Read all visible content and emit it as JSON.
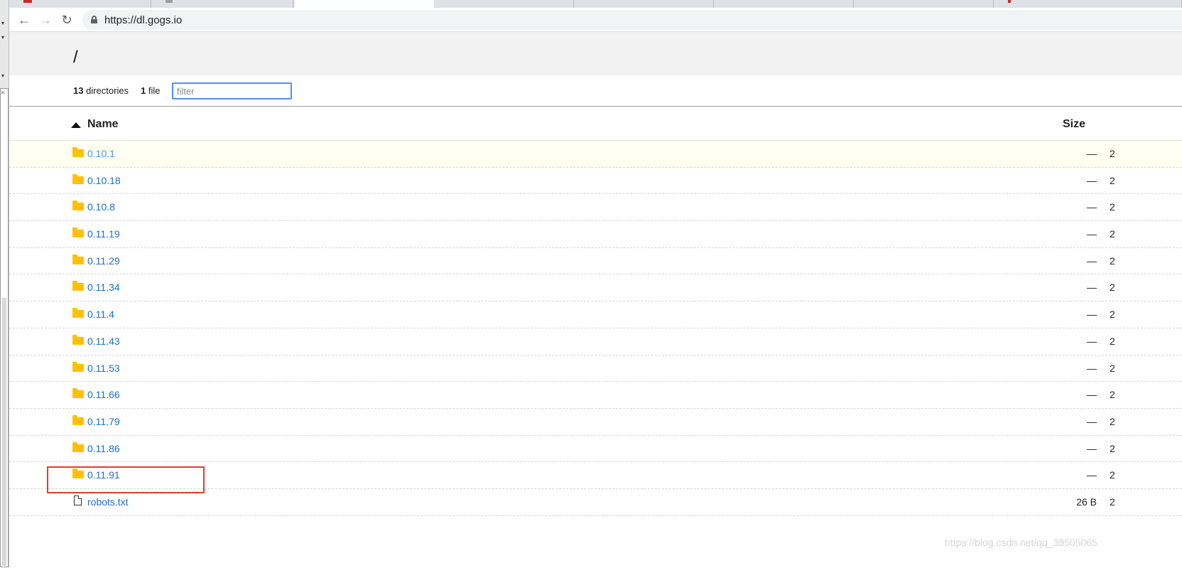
{
  "browser": {
    "url": "https://dl.gogs.io",
    "back_icon": "←",
    "forward_icon": "→",
    "reload_icon": "↻"
  },
  "page": {
    "path": "/",
    "dir_count": "13",
    "dir_label": "directories",
    "file_count": "1",
    "file_label": "file",
    "filter_placeholder": "filter",
    "columns": {
      "name": "Name",
      "size": "Size"
    }
  },
  "entries": [
    {
      "name": "0.10.1",
      "type": "folder",
      "size": "—",
      "date": "2"
    },
    {
      "name": "0.10.18",
      "type": "folder",
      "size": "—",
      "date": "2"
    },
    {
      "name": "0.10.8",
      "type": "folder",
      "size": "—",
      "date": "2"
    },
    {
      "name": "0.11.19",
      "type": "folder",
      "size": "—",
      "date": "2"
    },
    {
      "name": "0.11.29",
      "type": "folder",
      "size": "—",
      "date": "2"
    },
    {
      "name": "0.11.34",
      "type": "folder",
      "size": "—",
      "date": "2"
    },
    {
      "name": "0.11.4",
      "type": "folder",
      "size": "—",
      "date": "2"
    },
    {
      "name": "0.11.43",
      "type": "folder",
      "size": "—",
      "date": "2"
    },
    {
      "name": "0.11.53",
      "type": "folder",
      "size": "—",
      "date": "2"
    },
    {
      "name": "0.11.66",
      "type": "folder",
      "size": "—",
      "date": "2"
    },
    {
      "name": "0.11.79",
      "type": "folder",
      "size": "—",
      "date": "2"
    },
    {
      "name": "0.11.86",
      "type": "folder",
      "size": "—",
      "date": "2"
    },
    {
      "name": "0.11.91",
      "type": "folder",
      "size": "—",
      "date": "2"
    },
    {
      "name": "robots.txt",
      "type": "file",
      "size": "26 B",
      "date": "2"
    }
  ],
  "watermark": "https://blog.csdn.net/qq_39505065",
  "colors": {
    "link": "#1a6fc9",
    "folder": "#ffc107",
    "annotation": "#e53935",
    "filter_focus": "#4d90fe"
  }
}
